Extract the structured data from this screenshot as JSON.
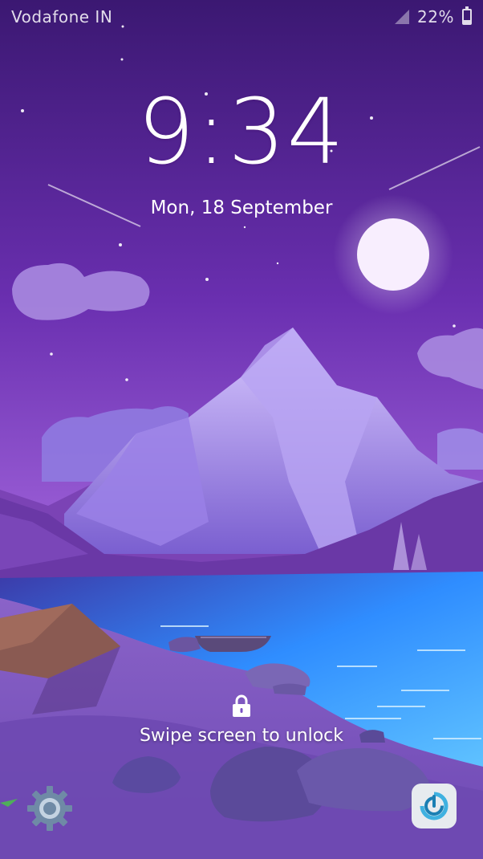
{
  "status_bar": {
    "carrier": "Vodafone IN",
    "battery_percent": "22%",
    "battery_level": 0.22,
    "icons": [
      "signal-icon",
      "battery-icon"
    ]
  },
  "lock_screen": {
    "time": "9:34",
    "date": "Mon, 18 September",
    "unlock_hint": "Swipe screen to unlock",
    "shortcuts": [
      "settings-gear-icon",
      "power-refresh-icon"
    ]
  },
  "colors": {
    "sky_top": "#3b1872",
    "sky_bottom": "#9a5ed6",
    "water": "#2f8dff",
    "accent": "#4ab7e8"
  }
}
